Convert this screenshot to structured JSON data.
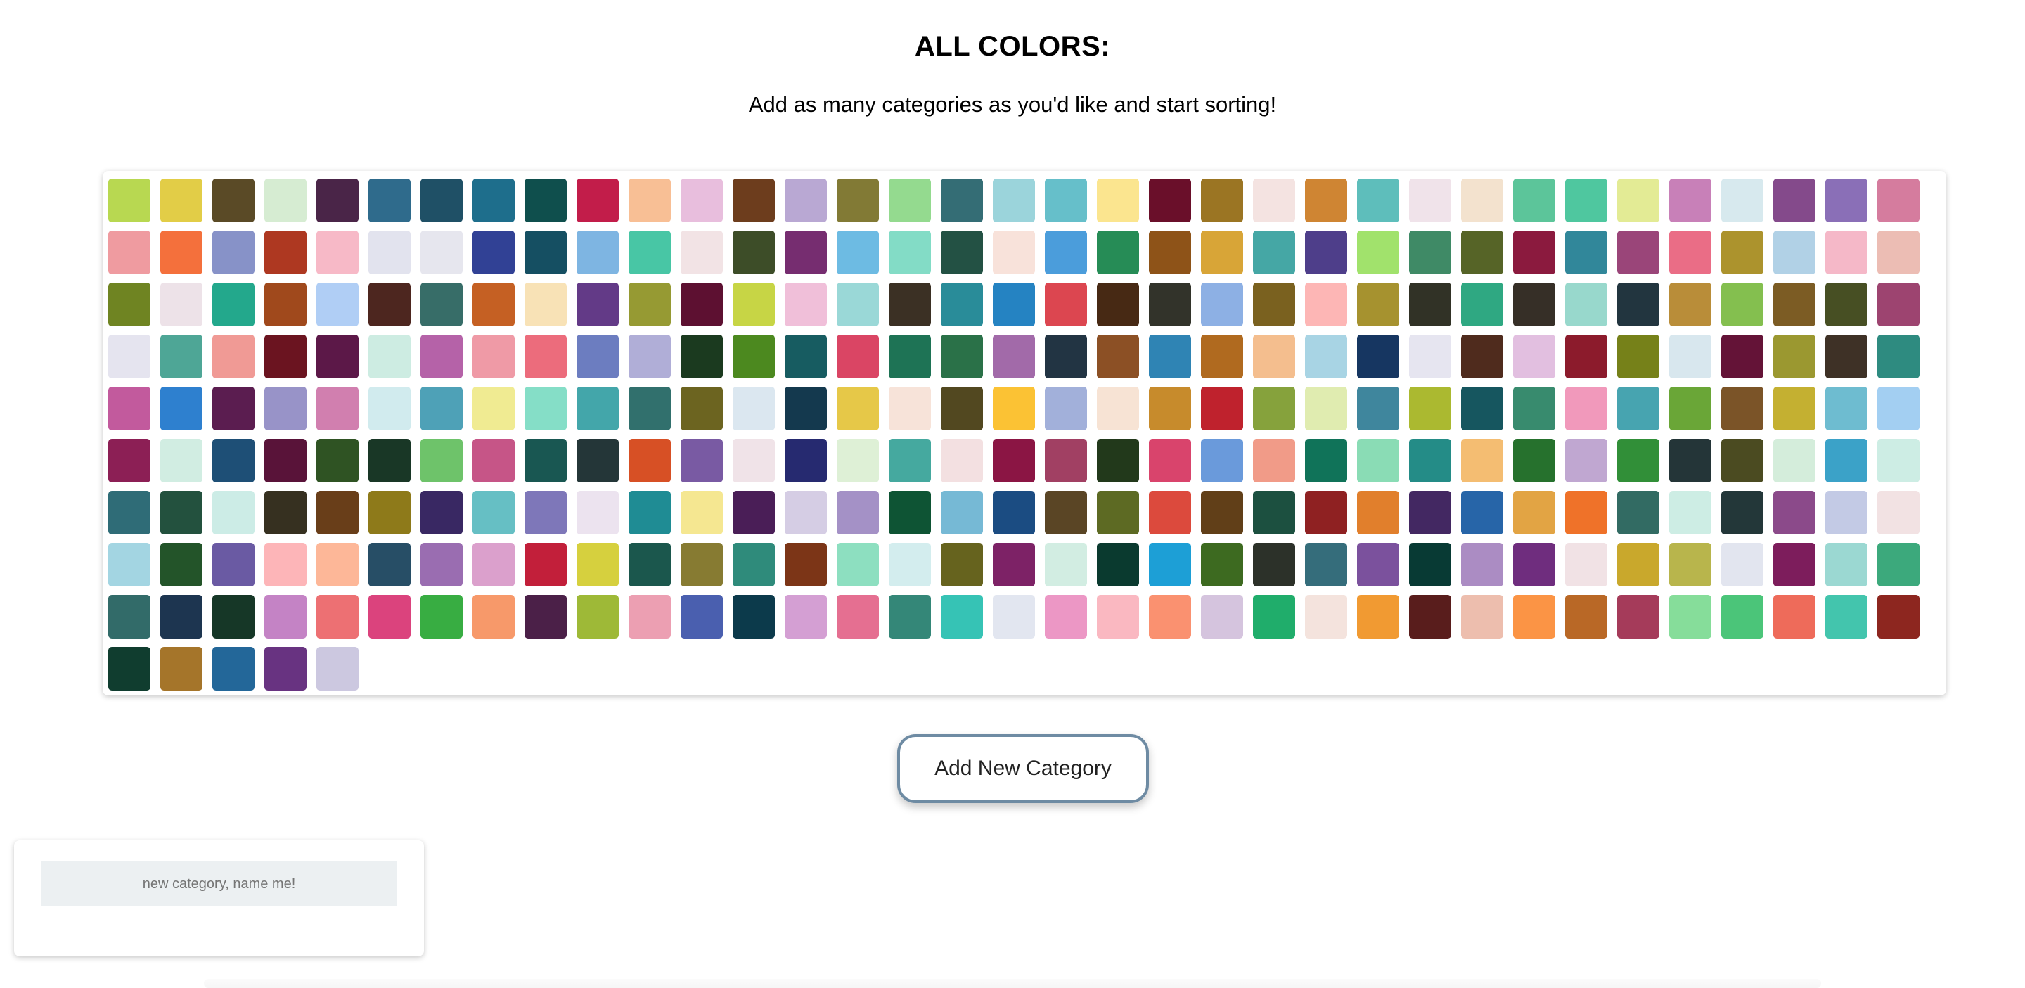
{
  "header": {
    "title": "ALL COLORS:",
    "subtitle": "Add as many categories as you'd like and start sorting!"
  },
  "palette": {
    "swatch_colors": [
      "#b8d851",
      "#e2cd47",
      "#5a4a26",
      "#d6ecd2",
      "#4a2548",
      "#2f6b8c",
      "#1f5066",
      "#1e6e8c",
      "#0f4f4d",
      "#c21d4a",
      "#f8bf95",
      "#e8bedd",
      "#6d3d1d",
      "#b9a8d3",
      "#827a35",
      "#94da8f",
      "#346d75",
      "#9bd4db",
      "#66bfca",
      "#fbe58f",
      "#6a0f2a",
      "#9b7523",
      "#f4e3e1",
      "#cf8533",
      "#5ebebb",
      "#f0e3ea",
      "#f3e2ce",
      "#5cc59a",
      "#4fc79f",
      "#e3eb95",
      "#c880b8",
      "#d7e9ee",
      "#844a8b",
      "#8a6fb7",
      "#d57c9e",
      "#ef9ba0",
      "#f4703c",
      "#8792c8",
      "#ae3821",
      "#f7b9c7",
      "#e2e3ee",
      "#e6e6ee",
      "#314195",
      "#154f62",
      "#7eb5e2",
      "#48c6a5",
      "#f2e3e5",
      "#3d4d28",
      "#762d70",
      "#6dbbe3",
      "#83dcc6",
      "#235144",
      "#f8e2da",
      "#4b9ddb",
      "#268c56",
      "#8e5318",
      "#d8a537",
      "#45a7a5",
      "#4e3e8a",
      "#a1e26c",
      "#3f8a66",
      "#566427",
      "#8b1a3e",
      "#31879a",
      "#9a4579",
      "#ea6d86",
      "#ac932d",
      "#b1d1e6",
      "#f5b8c8",
      "#ecbdb4",
      "#6f8422",
      "#ede2e8",
      "#23a88c",
      "#a0491c",
      "#b0cef5",
      "#4d261f",
      "#376d68",
      "#c56023",
      "#f8e2b6",
      "#633a87",
      "#969a33",
      "#5d1031",
      "#c7d545",
      "#f0bfd9",
      "#9ad8d7",
      "#3b3024",
      "#298c99",
      "#2583c2",
      "#dc4650",
      "#472914",
      "#32332a",
      "#8db0e4",
      "#7a611f",
      "#fdb6b5",
      "#a6922f",
      "#313226",
      "#2fa882",
      "#362f27",
      "#98d8cc",
      "#22353f",
      "#b98d39",
      "#84bf4f",
      "#7c5c24",
      "#474f23",
      "#9d4470",
      "#e5e4ef",
      "#4ea696",
      "#f09a95",
      "#6b1420",
      "#5c1848",
      "#cdece2",
      "#b562a8",
      "#ef9aa6",
      "#ec6c7c",
      "#6c7dc0",
      "#b0aed7",
      "#1b3a1f",
      "#4c891f",
      "#175c61",
      "#da4564",
      "#1e7355",
      "#2a7148",
      "#a26aa9",
      "#223443",
      "#8c5025",
      "#2f84b4",
      "#b06a1f",
      "#f4be8e",
      "#a8d4e4",
      "#163661",
      "#e6e5f0",
      "#4f2b1d",
      "#e2bfe0",
      "#8c1b2c",
      "#768119",
      "#d8e7ee",
      "#641337",
      "#9b9830",
      "#3e3126",
      "#2e8b80",
      "#c25a9d",
      "#2e80cf",
      "#5b1d50",
      "#9893c8",
      "#d17faf",
      "#d1ebee",
      "#4ea1b7",
      "#f0eb92",
      "#85dec7",
      "#43a6aa",
      "#31706d",
      "#6c6420",
      "#dbe7f0",
      "#14394e",
      "#e6c848",
      "#f7e3d9",
      "#524820",
      "#fbc234",
      "#a2b0da",
      "#f7e3d4",
      "#c78b2c",
      "#bf222d",
      "#86a23c",
      "#e0ecb0",
      "#3f869d",
      "#abb930",
      "#16565f",
      "#388b6e",
      "#f199bb",
      "#47a4b0",
      "#6aa637",
      "#7b5428",
      "#c4b031",
      "#6ebcd0",
      "#a3cff2",
      "#8c1f55",
      "#d1ede2",
      "#1e4f76",
      "#591339",
      "#2f5323",
      "#193726",
      "#6ec36a",
      "#c65587",
      "#195752",
      "#243638",
      "#d75025",
      "#795aa3",
      "#f0e3e8",
      "#262a70",
      "#def0d6",
      "#45a99f",
      "#f3e0e1",
      "#8b1544",
      "#a14063",
      "#22391b",
      "#d9446c",
      "#6a9adb",
      "#f19b88",
      "#107359",
      "#8adcb5",
      "#248c87",
      "#f4bd72",
      "#26712d",
      "#c0a7d1",
      "#318f38",
      "#243538",
      "#4b4b21",
      "#d4eddb",
      "#3ba2c8",
      "#cdede4",
      "#2f6c77",
      "#23513e",
      "#ccece6",
      "#363020",
      "#693e19",
      "#8e7a1a",
      "#392863",
      "#66bfc4",
      "#7e77b9",
      "#ece3ef",
      "#1f8c94",
      "#f5e791",
      "#4a1e57",
      "#d5cde4",
      "#a491c6",
      "#0e5434",
      "#76b9d5",
      "#1b4c82",
      "#5a4525",
      "#5d6a23",
      "#dc4a3d",
      "#613f18",
      "#1c5040",
      "#8f2122",
      "#e17f2c",
      "#432862",
      "#2765a8",
      "#e2a444",
      "#ef7229",
      "#326b63",
      "#cdede4",
      "#233739",
      "#8b4a8a",
      "#c3cae5",
      "#f2e2e3",
      "#a3d5e2",
      "#235429",
      "#6a5aa3",
      "#fdb5b8",
      "#fdb798",
      "#274e66",
      "#9a6db1",
      "#dba0cc",
      "#c21f3a",
      "#d6d03e",
      "#1b574d",
      "#877b32",
      "#2f8b7b",
      "#7c3517",
      "#8ddfc0",
      "#d3edee",
      "#66631e",
      "#7d2266",
      "#d2ede2",
      "#0a3a2f",
      "#1d9fd6",
      "#3d6a20",
      "#2c3129",
      "#356d7b",
      "#7b519d",
      "#083a34",
      "#ab8cc3",
      "#6f2d7e",
      "#f1e2e5",
      "#c9a82c",
      "#b8b54c",
      "#e2e5ef",
      "#7d1d5c",
      "#9bd8d2",
      "#3ca97c",
      "#326b69",
      "#1d3550",
      "#163727",
      "#c483c5",
      "#ed7073",
      "#db437d",
      "#38ad42",
      "#f7996a",
      "#4b2048",
      "#9eb937",
      "#ec9fb2",
      "#4a5faf",
      "#0c3a4b",
      "#d49fd3",
      "#e56f91",
      "#348778",
      "#36c3b5",
      "#e2e6f0",
      "#ec97c5",
      "#fab8c1",
      "#fa9170",
      "#d5c4de",
      "#20ad6b",
      "#f4e3dd",
      "#f19a32",
      "#591d1c",
      "#edbeae",
      "#fb9445",
      "#b96826",
      "#a53b5a",
      "#86dd9a",
      "#4bc579",
      "#ee6b5a",
      "#43c5ad",
      "#8d261f",
      "#103d2f",
      "#a5752a",
      "#236799",
      "#683381",
      "#ccc8e0"
    ]
  },
  "actions": {
    "add_category_label": "Add New Category"
  },
  "category": {
    "placeholder": "new category, name me!"
  }
}
